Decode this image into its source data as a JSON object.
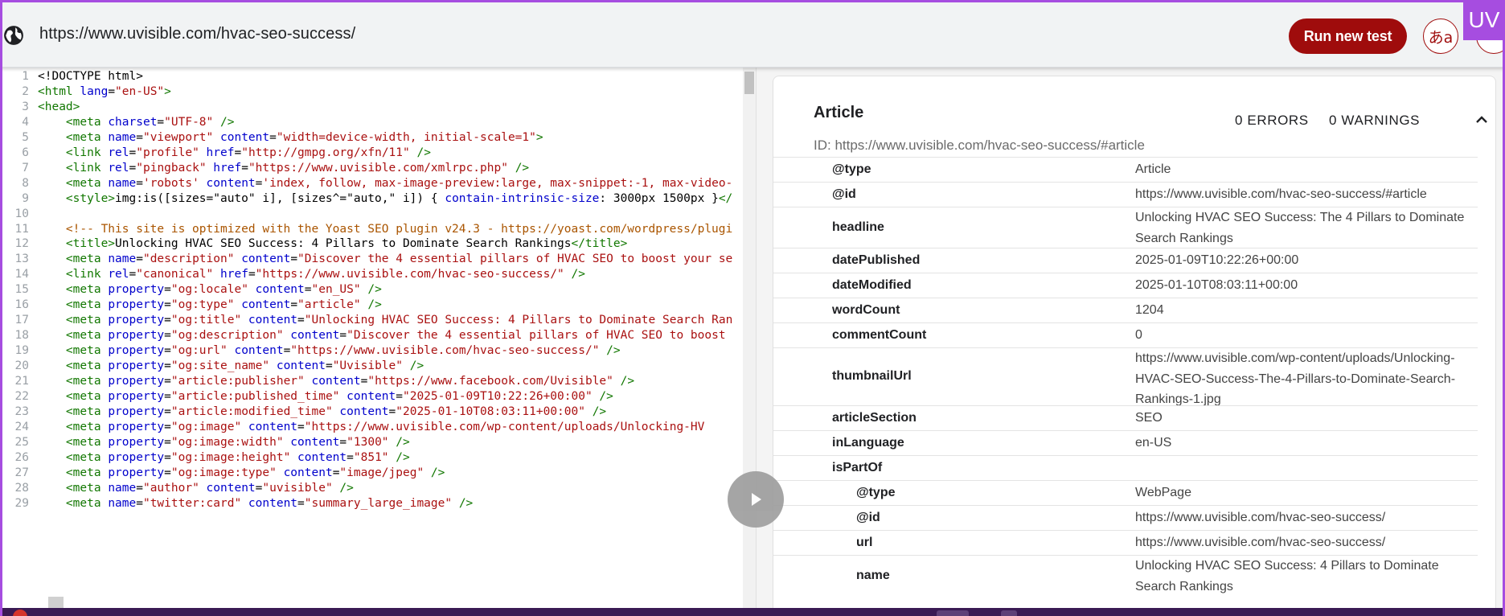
{
  "topbar": {
    "url": "https://www.uvisible.com/hvac-seo-success/",
    "run_button": "Run new test",
    "lang_button": "あa",
    "badge": "UV"
  },
  "code_lines": [
    {
      "n": "1",
      "parts": [
        [
          "t",
          "<!DOCTYPE html>"
        ]
      ]
    },
    {
      "n": "2",
      "parts": [
        [
          "g",
          "<html "
        ],
        [
          "a",
          "lang"
        ],
        [
          "t",
          "="
        ],
        [
          "s",
          "\"en-US\""
        ],
        [
          "g",
          ">"
        ]
      ]
    },
    {
      "n": "3",
      "parts": [
        [
          "g",
          "<head>"
        ]
      ]
    },
    {
      "n": "4",
      "parts": [
        [
          "t",
          "    "
        ],
        [
          "g",
          "<meta "
        ],
        [
          "a",
          "charset"
        ],
        [
          "t",
          "="
        ],
        [
          "s",
          "\"UTF-8\""
        ],
        [
          "g",
          " />"
        ]
      ]
    },
    {
      "n": "5",
      "parts": [
        [
          "t",
          "    "
        ],
        [
          "g",
          "<meta "
        ],
        [
          "a",
          "name"
        ],
        [
          "t",
          "="
        ],
        [
          "s",
          "\"viewport\""
        ],
        [
          "a",
          " content"
        ],
        [
          "t",
          "="
        ],
        [
          "s",
          "\"width=device-width, initial-scale=1\""
        ],
        [
          "g",
          ">"
        ]
      ]
    },
    {
      "n": "6",
      "parts": [
        [
          "t",
          "    "
        ],
        [
          "g",
          "<link "
        ],
        [
          "a",
          "rel"
        ],
        [
          "t",
          "="
        ],
        [
          "s",
          "\"profile\""
        ],
        [
          "a",
          " href"
        ],
        [
          "t",
          "="
        ],
        [
          "s",
          "\"http://gmpg.org/xfn/11\""
        ],
        [
          "g",
          " />"
        ]
      ]
    },
    {
      "n": "7",
      "parts": [
        [
          "t",
          "    "
        ],
        [
          "g",
          "<link "
        ],
        [
          "a",
          "rel"
        ],
        [
          "t",
          "="
        ],
        [
          "s",
          "\"pingback\""
        ],
        [
          "a",
          " href"
        ],
        [
          "t",
          "="
        ],
        [
          "s",
          "\"https://www.uvisible.com/xmlrpc.php\""
        ],
        [
          "g",
          " />"
        ]
      ]
    },
    {
      "n": "8",
      "parts": [
        [
          "t",
          "    "
        ],
        [
          "g",
          "<meta "
        ],
        [
          "a",
          "name"
        ],
        [
          "t",
          "="
        ],
        [
          "s",
          "'robots'"
        ],
        [
          "a",
          " content"
        ],
        [
          "t",
          "="
        ],
        [
          "s",
          "'index, follow, max-image-preview:large, max-snippet:-1, max-video-"
        ]
      ]
    },
    {
      "n": "9",
      "parts": [
        [
          "t",
          "    "
        ],
        [
          "g",
          "<style>"
        ],
        [
          "c",
          "img:is([sizes=\"auto\" i], [sizes^=\"auto,\" i]) { "
        ],
        [
          "a",
          "contain-intrinsic-size"
        ],
        [
          "c",
          ": 3000px 1500px }"
        ],
        [
          "g",
          "</"
        ]
      ]
    },
    {
      "n": "10",
      "parts": [
        [
          "t",
          ""
        ]
      ]
    },
    {
      "n": "11",
      "parts": [
        [
          "t",
          "    "
        ],
        [
          "m",
          "<!-- This site is optimized with the Yoast SEO plugin v24.3 - https://yoast.com/wordpress/plugi"
        ]
      ]
    },
    {
      "n": "12",
      "parts": [
        [
          "t",
          "    "
        ],
        [
          "g",
          "<title>"
        ],
        [
          "c",
          "Unlocking HVAC SEO Success: 4 Pillars to Dominate Search Rankings"
        ],
        [
          "g",
          "</title>"
        ]
      ]
    },
    {
      "n": "13",
      "parts": [
        [
          "t",
          "    "
        ],
        [
          "g",
          "<meta "
        ],
        [
          "a",
          "name"
        ],
        [
          "t",
          "="
        ],
        [
          "s",
          "\"description\""
        ],
        [
          "a",
          " content"
        ],
        [
          "t",
          "="
        ],
        [
          "s",
          "\"Discover the 4 essential pillars of HVAC SEO to boost your se"
        ]
      ]
    },
    {
      "n": "14",
      "parts": [
        [
          "t",
          "    "
        ],
        [
          "g",
          "<link "
        ],
        [
          "a",
          "rel"
        ],
        [
          "t",
          "="
        ],
        [
          "s",
          "\"canonical\""
        ],
        [
          "a",
          " href"
        ],
        [
          "t",
          "="
        ],
        [
          "s",
          "\"https://www.uvisible.com/hvac-seo-success/\""
        ],
        [
          "g",
          " />"
        ]
      ]
    },
    {
      "n": "15",
      "parts": [
        [
          "t",
          "    "
        ],
        [
          "g",
          "<meta "
        ],
        [
          "a",
          "property"
        ],
        [
          "t",
          "="
        ],
        [
          "s",
          "\"og:locale\""
        ],
        [
          "a",
          " content"
        ],
        [
          "t",
          "="
        ],
        [
          "s",
          "\"en_US\""
        ],
        [
          "g",
          " />"
        ]
      ]
    },
    {
      "n": "16",
      "parts": [
        [
          "t",
          "    "
        ],
        [
          "g",
          "<meta "
        ],
        [
          "a",
          "property"
        ],
        [
          "t",
          "="
        ],
        [
          "s",
          "\"og:type\""
        ],
        [
          "a",
          " content"
        ],
        [
          "t",
          "="
        ],
        [
          "s",
          "\"article\""
        ],
        [
          "g",
          " />"
        ]
      ]
    },
    {
      "n": "17",
      "parts": [
        [
          "t",
          "    "
        ],
        [
          "g",
          "<meta "
        ],
        [
          "a",
          "property"
        ],
        [
          "t",
          "="
        ],
        [
          "s",
          "\"og:title\""
        ],
        [
          "a",
          " content"
        ],
        [
          "t",
          "="
        ],
        [
          "s",
          "\"Unlocking HVAC SEO Success: 4 Pillars to Dominate Search Ran"
        ]
      ]
    },
    {
      "n": "18",
      "parts": [
        [
          "t",
          "    "
        ],
        [
          "g",
          "<meta "
        ],
        [
          "a",
          "property"
        ],
        [
          "t",
          "="
        ],
        [
          "s",
          "\"og:description\""
        ],
        [
          "a",
          " content"
        ],
        [
          "t",
          "="
        ],
        [
          "s",
          "\"Discover the 4 essential pillars of HVAC SEO to boost "
        ]
      ]
    },
    {
      "n": "19",
      "parts": [
        [
          "t",
          "    "
        ],
        [
          "g",
          "<meta "
        ],
        [
          "a",
          "property"
        ],
        [
          "t",
          "="
        ],
        [
          "s",
          "\"og:url\""
        ],
        [
          "a",
          " content"
        ],
        [
          "t",
          "="
        ],
        [
          "s",
          "\"https://www.uvisible.com/hvac-seo-success/\""
        ],
        [
          "g",
          " />"
        ]
      ]
    },
    {
      "n": "20",
      "parts": [
        [
          "t",
          "    "
        ],
        [
          "g",
          "<meta "
        ],
        [
          "a",
          "property"
        ],
        [
          "t",
          "="
        ],
        [
          "s",
          "\"og:site_name\""
        ],
        [
          "a",
          " content"
        ],
        [
          "t",
          "="
        ],
        [
          "s",
          "\"Uvisible\""
        ],
        [
          "g",
          " />"
        ]
      ]
    },
    {
      "n": "21",
      "parts": [
        [
          "t",
          "    "
        ],
        [
          "g",
          "<meta "
        ],
        [
          "a",
          "property"
        ],
        [
          "t",
          "="
        ],
        [
          "s",
          "\"article:publisher\""
        ],
        [
          "a",
          " content"
        ],
        [
          "t",
          "="
        ],
        [
          "s",
          "\"https://www.facebook.com/Uvisible\""
        ],
        [
          "g",
          " />"
        ]
      ]
    },
    {
      "n": "22",
      "parts": [
        [
          "t",
          "    "
        ],
        [
          "g",
          "<meta "
        ],
        [
          "a",
          "property"
        ],
        [
          "t",
          "="
        ],
        [
          "s",
          "\"article:published_time\""
        ],
        [
          "a",
          " content"
        ],
        [
          "t",
          "="
        ],
        [
          "s",
          "\"2025-01-09T10:22:26+00:00\""
        ],
        [
          "g",
          " />"
        ]
      ]
    },
    {
      "n": "23",
      "parts": [
        [
          "t",
          "    "
        ],
        [
          "g",
          "<meta "
        ],
        [
          "a",
          "property"
        ],
        [
          "t",
          "="
        ],
        [
          "s",
          "\"article:modified_time\""
        ],
        [
          "a",
          " content"
        ],
        [
          "t",
          "="
        ],
        [
          "s",
          "\"2025-01-10T08:03:11+00:00\""
        ],
        [
          "g",
          " />"
        ]
      ]
    },
    {
      "n": "24",
      "parts": [
        [
          "t",
          "    "
        ],
        [
          "g",
          "<meta "
        ],
        [
          "a",
          "property"
        ],
        [
          "t",
          "="
        ],
        [
          "s",
          "\"og:image\""
        ],
        [
          "a",
          " content"
        ],
        [
          "t",
          "="
        ],
        [
          "s",
          "\"https://www.uvisible.com/wp-content/uploads/Unlocking-HV"
        ]
      ]
    },
    {
      "n": "25",
      "parts": [
        [
          "t",
          "    "
        ],
        [
          "g",
          "<meta "
        ],
        [
          "a",
          "property"
        ],
        [
          "t",
          "="
        ],
        [
          "s",
          "\"og:image:width\""
        ],
        [
          "a",
          " content"
        ],
        [
          "t",
          "="
        ],
        [
          "s",
          "\"1300\""
        ],
        [
          "g",
          " />"
        ]
      ]
    },
    {
      "n": "26",
      "parts": [
        [
          "t",
          "    "
        ],
        [
          "g",
          "<meta "
        ],
        [
          "a",
          "property"
        ],
        [
          "t",
          "="
        ],
        [
          "s",
          "\"og:image:height\""
        ],
        [
          "a",
          " content"
        ],
        [
          "t",
          "="
        ],
        [
          "s",
          "\"851\""
        ],
        [
          "g",
          " />"
        ]
      ]
    },
    {
      "n": "27",
      "parts": [
        [
          "t",
          "    "
        ],
        [
          "g",
          "<meta "
        ],
        [
          "a",
          "property"
        ],
        [
          "t",
          "="
        ],
        [
          "s",
          "\"og:image:type\""
        ],
        [
          "a",
          " content"
        ],
        [
          "t",
          "="
        ],
        [
          "s",
          "\"image/jpeg\""
        ],
        [
          "g",
          " />"
        ]
      ]
    },
    {
      "n": "28",
      "parts": [
        [
          "t",
          "    "
        ],
        [
          "g",
          "<meta "
        ],
        [
          "a",
          "name"
        ],
        [
          "t",
          "="
        ],
        [
          "s",
          "\"author\""
        ],
        [
          "a",
          " content"
        ],
        [
          "t",
          "="
        ],
        [
          "s",
          "\"uvisible\""
        ],
        [
          "g",
          " />"
        ]
      ]
    },
    {
      "n": "29",
      "parts": [
        [
          "t",
          "    "
        ],
        [
          "g",
          "<meta "
        ],
        [
          "a",
          "name"
        ],
        [
          "t",
          "="
        ],
        [
          "s",
          "\"twitter:card\""
        ],
        [
          "a",
          " content"
        ],
        [
          "t",
          "="
        ],
        [
          "s",
          "\"summary_large_image\""
        ],
        [
          "g",
          " />"
        ]
      ]
    }
  ],
  "card": {
    "title": "Article",
    "errors": "0 ERRORS",
    "warnings": "0 WARNINGS",
    "id_line": "ID: https://www.uvisible.com/hvac-seo-success/#article",
    "rows": [
      {
        "key": "@type",
        "value": "Article",
        "nested": false
      },
      {
        "key": "@id",
        "value": "https://www.uvisible.com/hvac-seo-success/#article",
        "nested": false
      },
      {
        "key": "headline",
        "value": "Unlocking HVAC SEO Success: The 4 Pillars to Dominate Search Rankings",
        "nested": false
      },
      {
        "key": "datePublished",
        "value": "2025-01-09T10:22:26+00:00",
        "nested": false
      },
      {
        "key": "dateModified",
        "value": "2025-01-10T08:03:11+00:00",
        "nested": false
      },
      {
        "key": "wordCount",
        "value": "1204",
        "nested": false
      },
      {
        "key": "commentCount",
        "value": "0",
        "nested": false
      },
      {
        "key": "thumbnailUrl",
        "value": "https://www.uvisible.com/wp-content/uploads/Unlocking-HVAC-SEO-Success-The-4-Pillars-to-Dominate-Search-Rankings-1.jpg",
        "nested": false
      },
      {
        "key": "articleSection",
        "value": "SEO",
        "nested": false
      },
      {
        "key": "inLanguage",
        "value": "en-US",
        "nested": false
      },
      {
        "key": "isPartOf",
        "value": "",
        "nested": false
      },
      {
        "key": "@type",
        "value": "WebPage",
        "nested": true
      },
      {
        "key": "@id",
        "value": "https://www.uvisible.com/hvac-seo-success/",
        "nested": true
      },
      {
        "key": "url",
        "value": "https://www.uvisible.com/hvac-seo-success/",
        "nested": true
      },
      {
        "key": "name",
        "value": "Unlocking HVAC SEO Success: 4 Pillars to Dominate Search Rankings",
        "nested": true
      }
    ]
  },
  "colors": {
    "accent": "#9f0c0c",
    "frame": "#a64de0"
  }
}
